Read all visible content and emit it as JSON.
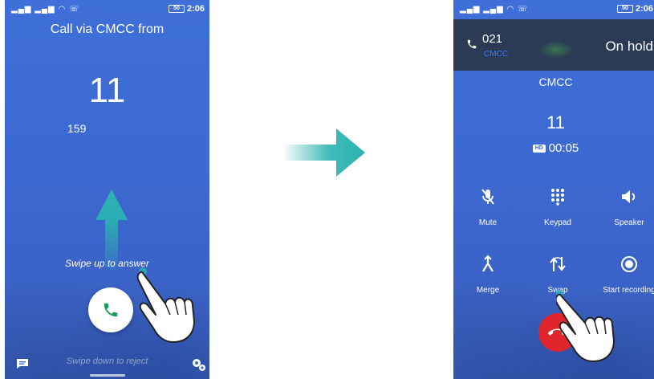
{
  "left_screen": {
    "status_time": "2:06",
    "battery_label": "50",
    "call_via": "Call via CMCC from",
    "incoming_number": "11",
    "sub_number": "159",
    "swipe_up_hint": "Swipe up to answer",
    "swipe_down_hint": "Swipe down to reject",
    "icons": [
      "message-icon",
      "phone-icon",
      "settings-icon",
      "up-arrow-icon",
      "hand-pointer-icon"
    ]
  },
  "right_screen": {
    "status_time": "2:06",
    "battery_label": "50",
    "hold_number": "021",
    "hold_carrier": "CMCC",
    "hold_status": "On hold",
    "carrier": "CMCC",
    "call_number": "11",
    "hd_badge": "HD",
    "call_duration": "00:05",
    "controls": [
      {
        "label": "Mute",
        "icon": "mute-icon"
      },
      {
        "label": "Keypad",
        "icon": "keypad-icon"
      },
      {
        "label": "Speaker",
        "icon": "speaker-icon"
      },
      {
        "label": "Merge",
        "icon": "merge-icon"
      },
      {
        "label": "Swap",
        "icon": "swap-icon"
      },
      {
        "label": "Start recording",
        "icon": "record-icon"
      }
    ]
  },
  "colors": {
    "screen_blue": "#3f6fd8",
    "arrow_teal": "#2bb3b1",
    "answer_green": "#1a9d5a",
    "hangup_red": "#e0252d",
    "hold_bar": "#2b3a55"
  }
}
